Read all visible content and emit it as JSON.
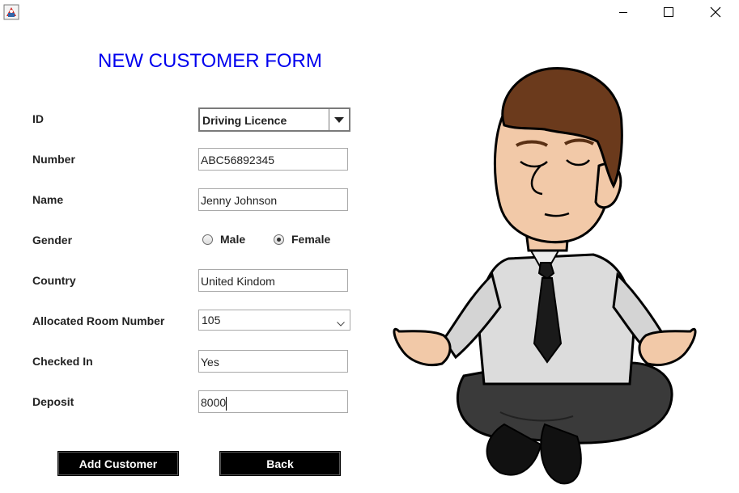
{
  "window": {
    "minimize_icon": "minimize-icon",
    "maximize_icon": "maximize-icon",
    "close_icon": "close-icon"
  },
  "form": {
    "title": "NEW CUSTOMER FORM",
    "fields": {
      "id": {
        "label": "ID",
        "value": "Driving Licence"
      },
      "number": {
        "label": "Number",
        "value": "ABC56892345"
      },
      "name": {
        "label": "Name",
        "value": "Jenny Johnson"
      },
      "gender": {
        "label": "Gender",
        "options": [
          "Male",
          "Female"
        ],
        "selected": "Female"
      },
      "country": {
        "label": "Country",
        "value": "United Kindom"
      },
      "room": {
        "label": "Allocated Room Number",
        "value": "105"
      },
      "checked_in": {
        "label": "Checked In",
        "value": "Yes"
      },
      "deposit": {
        "label": "Deposit",
        "value": "8000"
      }
    }
  },
  "buttons": {
    "add": "Add Customer",
    "back": "Back"
  },
  "colors": {
    "title": "#0000ee",
    "button_bg": "#000000",
    "button_text": "#ffffff"
  }
}
